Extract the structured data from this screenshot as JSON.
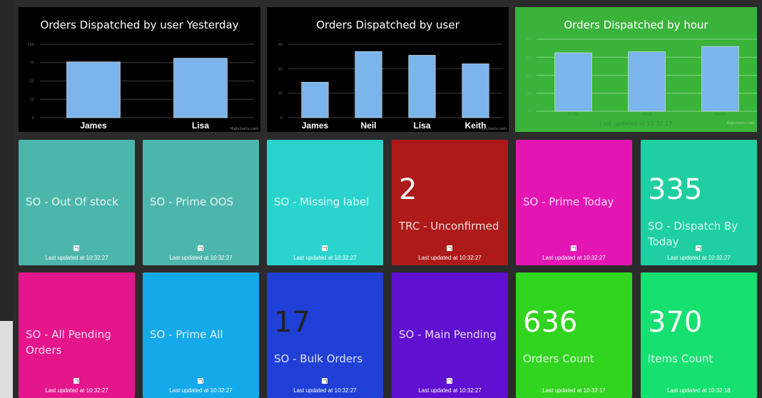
{
  "charts": {
    "yesterday": {
      "title": "Orders Dispatched by user Yesterday",
      "watermark": "Highcharts.com"
    },
    "by_user": {
      "title": "Orders Dispatched by user",
      "watermark": "Highcharts.com"
    },
    "by_hour": {
      "title": "Orders Dispatched by hour",
      "updated": "Last updated at 10:32:17",
      "watermark": "Highcharts.com"
    }
  },
  "chart_data": [
    {
      "type": "bar",
      "title": "Orders Dispatched by user Yesterday",
      "categories": [
        "James",
        "Lisa"
      ],
      "values": [
        76,
        81
      ],
      "ylim": [
        0,
        100
      ],
      "yticks": [
        0,
        25,
        50,
        75,
        100
      ],
      "background": "#000000",
      "bar_color": "#7cb5ec",
      "grid": true
    },
    {
      "type": "bar",
      "title": "Orders Dispatched by user",
      "categories": [
        "James",
        "Neil",
        "Lisa",
        "Keith"
      ],
      "values": [
        29,
        54,
        51,
        44
      ],
      "ylim": [
        0,
        60
      ],
      "yticks": [
        0,
        20,
        40,
        60
      ],
      "background": "#000000",
      "bar_color": "#7cb5ec",
      "grid": true
    },
    {
      "type": "bar",
      "title": "Orders Dispatched by hour",
      "categories": [
        "07:00",
        "08:00",
        "09:00"
      ],
      "values": [
        65,
        66,
        72
      ],
      "ylim": [
        0,
        80
      ],
      "yticks": [
        0,
        20,
        40,
        60,
        80
      ],
      "background": "#3bb33b",
      "bar_color": "#7cb5ec",
      "grid": true
    }
  ],
  "tiles": [
    {
      "label": "SO - Out Of stock",
      "value": "",
      "updated": "Last updated at 10:32:27",
      "color": "#4db6ac"
    },
    {
      "label": "SO - Prime OOS",
      "value": "",
      "updated": "Last updated at 10:32:27",
      "color": "#4db6ac"
    },
    {
      "label": "SO - Missing label",
      "value": "",
      "updated": "Last updated at 10:32:27",
      "color": "#2ad4cc"
    },
    {
      "label": "TRC - Unconfirmed",
      "value": "2",
      "updated": "Last updated at 10:32:27",
      "color": "#ae1a1a"
    },
    {
      "label": "SO - Prime Today",
      "value": "",
      "updated": "Last updated at 10:32:27",
      "color": "#e316b3"
    },
    {
      "label": "SO - Dispatch By Today",
      "value": "335",
      "updated": "Last updated at 10:32:27",
      "color": "#1fcfa2"
    },
    {
      "label": "SO - All Pending Orders",
      "value": "",
      "updated": "Last updated at 10:32:27",
      "color": "#e5168c"
    },
    {
      "label": "SO - Prime All",
      "value": "",
      "updated": "Last updated at 10:32:27",
      "color": "#14aae9"
    },
    {
      "label": "SO - Bulk Orders",
      "value": "17",
      "updated": "Last updated at 10:32:27",
      "color": "#1f3fd6"
    },
    {
      "label": "SO - Main Pending",
      "value": "",
      "updated": "Last updated at 10:32:27",
      "color": "#6010d0"
    },
    {
      "label": "Orders Count",
      "value": "636",
      "updated": "Last updated at 10:32:17",
      "color": "#31d41f"
    },
    {
      "label": "Items Count",
      "value": "370",
      "updated": "Last updated at 10:32:18",
      "color": "#16e070"
    }
  ]
}
